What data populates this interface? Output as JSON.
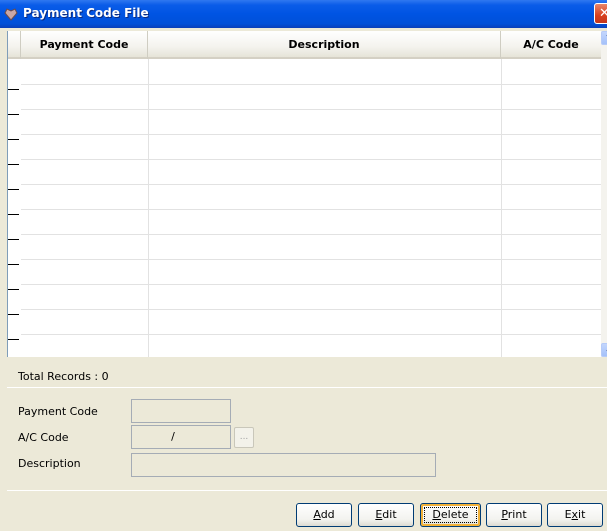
{
  "window": {
    "title": "Payment Code File",
    "close_glyph": "✕",
    "icon": "app-icon"
  },
  "grid": {
    "columns": [
      "Payment Code",
      "Description",
      "A/C Code"
    ],
    "rows": [
      [
        "",
        "",
        ""
      ],
      [
        "",
        "",
        ""
      ],
      [
        "",
        "",
        ""
      ],
      [
        "",
        "",
        ""
      ],
      [
        "",
        "",
        ""
      ],
      [
        "",
        "",
        ""
      ],
      [
        "",
        "",
        ""
      ],
      [
        "",
        "",
        ""
      ],
      [
        "",
        "",
        ""
      ],
      [
        "",
        "",
        ""
      ],
      [
        "",
        "",
        ""
      ],
      [
        "",
        "",
        ""
      ]
    ],
    "scroll_up_glyph": "⌃",
    "scroll_down_glyph": "⌄"
  },
  "status": {
    "total_records_label": "Total Records : 0"
  },
  "form": {
    "payment_code_label": "Payment Code",
    "payment_code_value": "",
    "ac_code_label": "A/C Code",
    "ac_code_value": "/",
    "lookup_button_label": "...",
    "description_label": "Description",
    "description_value": ""
  },
  "buttons": {
    "add": {
      "hotkey": "A",
      "rest": "dd"
    },
    "edit": {
      "hotkey": "E",
      "rest": "dit"
    },
    "delete": {
      "hotkey": "D",
      "rest": "elete"
    },
    "print": {
      "hotkey": "P",
      "rest": "rint"
    },
    "exit": {
      "pre": "E",
      "hotkey": "x",
      "rest": "it"
    }
  },
  "colors": {
    "titlebar": "#0054e3",
    "window_bg": "#ece9d8",
    "close_button": "#d8401e",
    "button_border": "#003c74",
    "focus_highlight": "#f2b23a"
  }
}
